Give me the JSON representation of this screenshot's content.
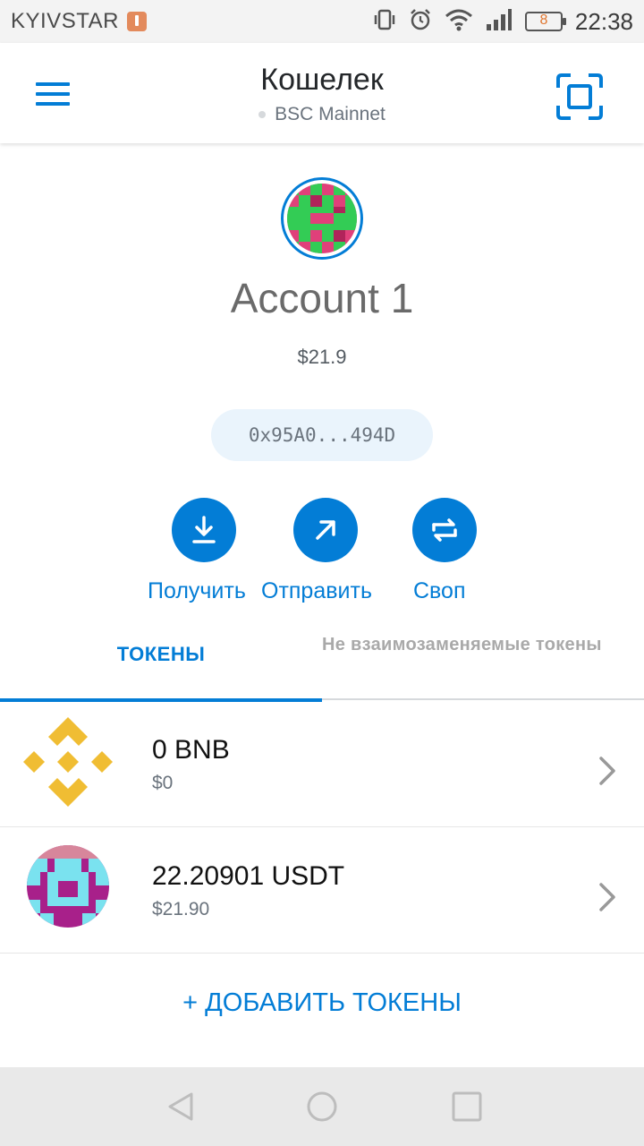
{
  "status_bar": {
    "carrier": "KYIVSTAR",
    "battery_level": "8",
    "time": "22:38"
  },
  "header": {
    "title": "Кошелек",
    "network": "BSC Mainnet"
  },
  "account": {
    "name": "Account 1",
    "balance": "$21.9",
    "address": "0x95A0...494D"
  },
  "actions": {
    "receive": "Получить",
    "send": "Отправить",
    "swap": "Своп"
  },
  "tabs": {
    "tokens": "ТОКЕНЫ",
    "nft": "Не взаимозаменяемые токены"
  },
  "tokens": [
    {
      "amount": "0 BNB",
      "fiat": "$0",
      "icon": "bnb-icon"
    },
    {
      "amount": "22.20901 USDT",
      "fiat": "$21.90",
      "icon": "usdt-identicon"
    }
  ],
  "add_tokens": "+ ДОБАВИТЬ ТОКЕНЫ",
  "colors": {
    "accent": "#037dd6",
    "bnb": "#f0b90b"
  }
}
